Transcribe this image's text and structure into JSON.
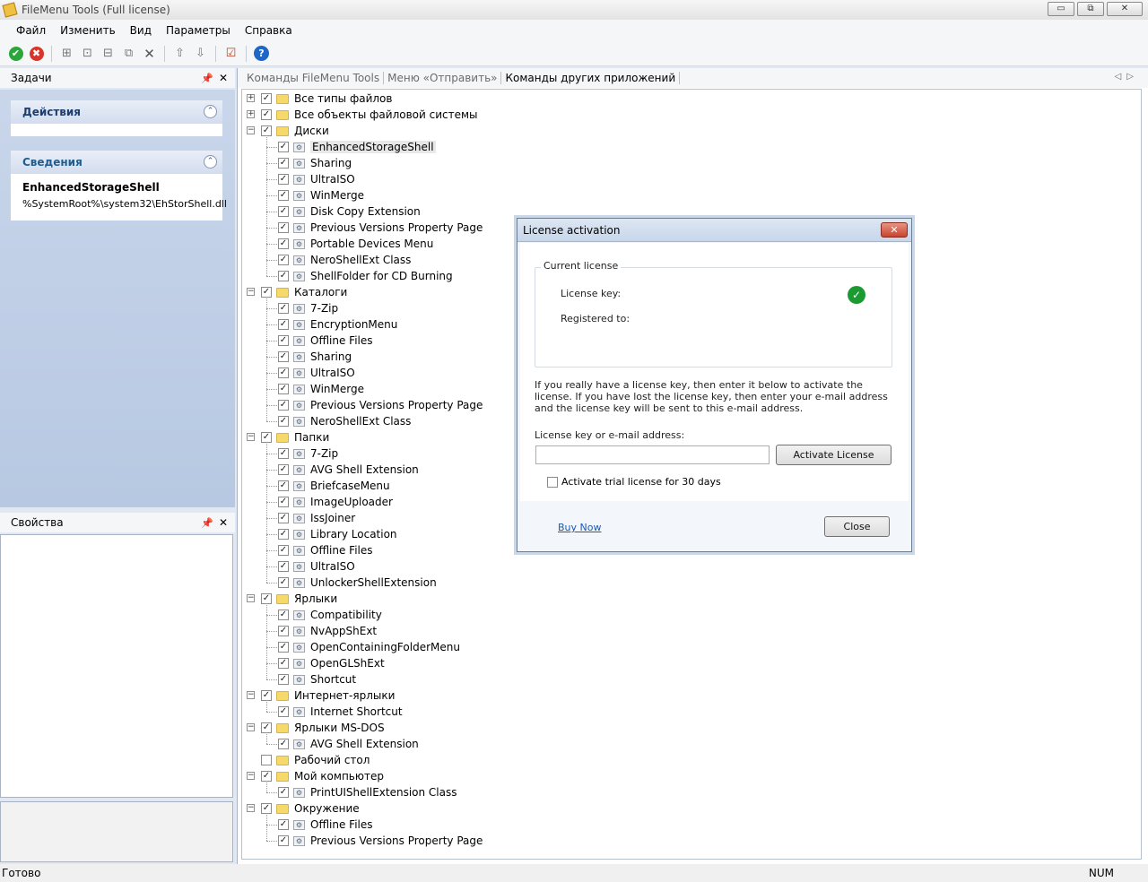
{
  "window": {
    "title": "FileMenu Tools (Full license)",
    "min": "▭",
    "max": "⧉",
    "close": "✕"
  },
  "menu": [
    "Файл",
    "Изменить",
    "Вид",
    "Параметры",
    "Справка"
  ],
  "toolbar_icons": [
    "check-icon",
    "cancel-icon",
    "new-folder-icon",
    "new-item-icon",
    "new-submenu-icon",
    "copy-icon",
    "delete-icon",
    "move-up-icon",
    "move-down-icon",
    "check-all-icon",
    "help-icon"
  ],
  "tasks_pane": {
    "title": "Задачи",
    "actions_card": {
      "title": "Действия"
    },
    "info_card": {
      "title": "Сведения",
      "name": "EnhancedStorageShell",
      "path": "%SystemRoot%\\system32\\EhStorShell.dll"
    }
  },
  "props_pane": {
    "title": "Свойства"
  },
  "tabs": [
    "Команды FileMenu Tools",
    "Меню «Отправить»",
    "Команды других приложений"
  ],
  "tree": [
    {
      "label": "Все типы файлов",
      "level": 0,
      "folder": true,
      "expander": "+",
      "checked": true
    },
    {
      "label": "Все объекты файловой системы",
      "level": 0,
      "folder": true,
      "expander": "+",
      "checked": true
    },
    {
      "label": "Диски",
      "level": 0,
      "folder": true,
      "expander": "−",
      "checked": true
    },
    {
      "label": "EnhancedStorageShell",
      "level": 1,
      "checked": true,
      "selected": true
    },
    {
      "label": "Sharing",
      "level": 1,
      "checked": true
    },
    {
      "label": "UltraISO",
      "level": 1,
      "checked": true
    },
    {
      "label": "WinMerge",
      "level": 1,
      "checked": true
    },
    {
      "label": "Disk Copy Extension",
      "level": 1,
      "checked": true
    },
    {
      "label": "Previous Versions Property Page",
      "level": 1,
      "checked": true
    },
    {
      "label": "Portable Devices Menu",
      "level": 1,
      "checked": true
    },
    {
      "label": "NeroShellExt Class",
      "level": 1,
      "checked": true
    },
    {
      "label": "ShellFolder for CD Burning",
      "level": 1,
      "checked": true
    },
    {
      "label": "Каталоги",
      "level": 0,
      "folder": true,
      "expander": "−",
      "checked": true
    },
    {
      "label": "7-Zip",
      "level": 1,
      "checked": true
    },
    {
      "label": "EncryptionMenu",
      "level": 1,
      "checked": true
    },
    {
      "label": "Offline Files",
      "level": 1,
      "checked": true
    },
    {
      "label": "Sharing",
      "level": 1,
      "checked": true
    },
    {
      "label": "UltraISO",
      "level": 1,
      "checked": true
    },
    {
      "label": "WinMerge",
      "level": 1,
      "checked": true
    },
    {
      "label": "Previous Versions Property Page",
      "level": 1,
      "checked": true
    },
    {
      "label": "NeroShellExt Class",
      "level": 1,
      "checked": true
    },
    {
      "label": "Папки",
      "level": 0,
      "folder": true,
      "expander": "−",
      "checked": true
    },
    {
      "label": "7-Zip",
      "level": 1,
      "checked": true
    },
    {
      "label": "AVG Shell Extension",
      "level": 1,
      "checked": true
    },
    {
      "label": "BriefcaseMenu",
      "level": 1,
      "checked": true
    },
    {
      "label": "ImageUploader",
      "level": 1,
      "checked": true
    },
    {
      "label": "IssJoiner",
      "level": 1,
      "checked": true
    },
    {
      "label": "Library Location",
      "level": 1,
      "checked": true
    },
    {
      "label": "Offline Files",
      "level": 1,
      "checked": true
    },
    {
      "label": "UltraISO",
      "level": 1,
      "checked": true
    },
    {
      "label": "UnlockerShellExtension",
      "level": 1,
      "checked": true
    },
    {
      "label": "Ярлыки",
      "level": 0,
      "folder": true,
      "expander": "−",
      "checked": true
    },
    {
      "label": "Compatibility",
      "level": 1,
      "checked": true
    },
    {
      "label": "NvAppShExt",
      "level": 1,
      "checked": true
    },
    {
      "label": "OpenContainingFolderMenu",
      "level": 1,
      "checked": true
    },
    {
      "label": "OpenGLShExt",
      "level": 1,
      "checked": true
    },
    {
      "label": "Shortcut",
      "level": 1,
      "checked": true
    },
    {
      "label": "Интернет-ярлыки",
      "level": 0,
      "folder": true,
      "expander": "−",
      "checked": true
    },
    {
      "label": "Internet Shortcut",
      "level": 1,
      "checked": true
    },
    {
      "label": "Ярлыки MS-DOS",
      "level": 0,
      "folder": true,
      "expander": "−",
      "checked": true
    },
    {
      "label": "AVG Shell Extension",
      "level": 1,
      "checked": true
    },
    {
      "label": "Рабочий стол",
      "level": 0,
      "folder": true,
      "expander": "",
      "checked": false
    },
    {
      "label": "Мой компьютер",
      "level": 0,
      "folder": true,
      "expander": "−",
      "checked": true
    },
    {
      "label": "PrintUIShellExtension Class",
      "level": 1,
      "checked": true
    },
    {
      "label": "Окружение",
      "level": 0,
      "folder": true,
      "expander": "−",
      "checked": true
    },
    {
      "label": "Offline Files",
      "level": 1,
      "checked": true
    },
    {
      "label": "Previous Versions Property Page",
      "level": 1,
      "checked": true
    }
  ],
  "dialog": {
    "title": "License activation",
    "group_title": "Current license",
    "license_key_label": "License key:",
    "registered_to_label": "Registered to:",
    "info": "If you really have a license key, then enter it below to activate the license. If you have lost the license key, then enter your e-mail address and the license key will be sent to this e-mail address.",
    "email_label": "License key or e-mail address:",
    "email_value": "",
    "activate_button": "Activate License",
    "trial_label": "Activate trial license for 30 days",
    "trial_checked": false,
    "buy_link": "Buy Now",
    "close_button": "Close"
  },
  "status": {
    "text": "Готово",
    "num": "NUM"
  },
  "colors": {
    "ok_green": "#1c9a32",
    "cancel_red": "#d9342b",
    "pane_blue": "#b7c8e2",
    "link": "#1a5ab0"
  }
}
